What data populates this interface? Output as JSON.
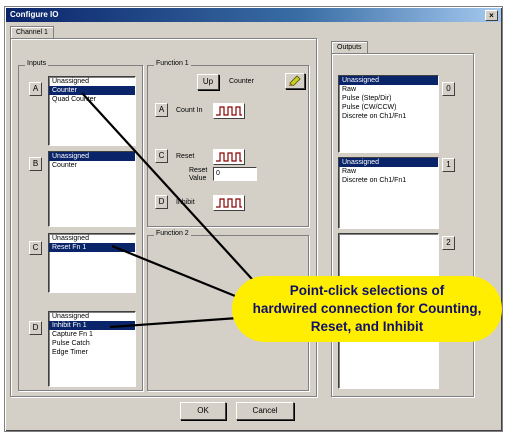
{
  "window": {
    "title": "Configure IO",
    "close": "×"
  },
  "tabs": {
    "channel": "Channel 1",
    "outputs": "Outputs"
  },
  "inputs": {
    "label": "Inputs",
    "lists": [
      {
        "letter": "A",
        "items": [
          "Unassigned",
          "Counter",
          "Quad Counter"
        ],
        "selected": 1
      },
      {
        "letter": "B",
        "items": [
          "Unassigned",
          "Counter"
        ],
        "selected": 0
      },
      {
        "letter": "C",
        "items": [
          "Unassigned",
          "Reset Fn 1"
        ],
        "selected": 1
      },
      {
        "letter": "D",
        "items": [
          "Unassigned",
          "Inhibit Fn 1",
          "Capture Fn 1",
          "Pulse Catch",
          "Edge Timer"
        ],
        "selected": 1
      }
    ]
  },
  "function1": {
    "label": "Function 1",
    "up_button": "Up",
    "counter_label": "Counter",
    "count_in_letter": "A",
    "count_in_label": "Count In",
    "reset_letter": "C",
    "reset_label": "Reset",
    "reset_value_line1": "Reset",
    "reset_value_line2": "Value",
    "reset_value": "0",
    "inhibit_letter": "D",
    "inhibit_label": "Inhibit"
  },
  "function2": {
    "label": "Function 2"
  },
  "outputs": {
    "lists": [
      {
        "number": "0",
        "items": [
          "Unassigned",
          "Raw",
          "Pulse (Step/Dir)",
          "Pulse (CW/CCW)",
          "Discrete on Ch1/Fn1"
        ],
        "selected": 0
      },
      {
        "number": "1",
        "items": [
          "Unassigned",
          "Raw",
          "Discrete on Ch1/Fn1"
        ],
        "selected": 0
      },
      {
        "number": "2",
        "items": [],
        "selected": -1
      }
    ]
  },
  "footer": {
    "ok": "OK",
    "cancel": "Cancel"
  },
  "callout": {
    "line1": "Point-click selections of",
    "line2": "hardwired connection for Counting,",
    "line3": "Reset, and Inhibit"
  },
  "colors": {
    "selection": "#0a246a",
    "callout": "#ffee00",
    "callout_text": "#10106a"
  }
}
